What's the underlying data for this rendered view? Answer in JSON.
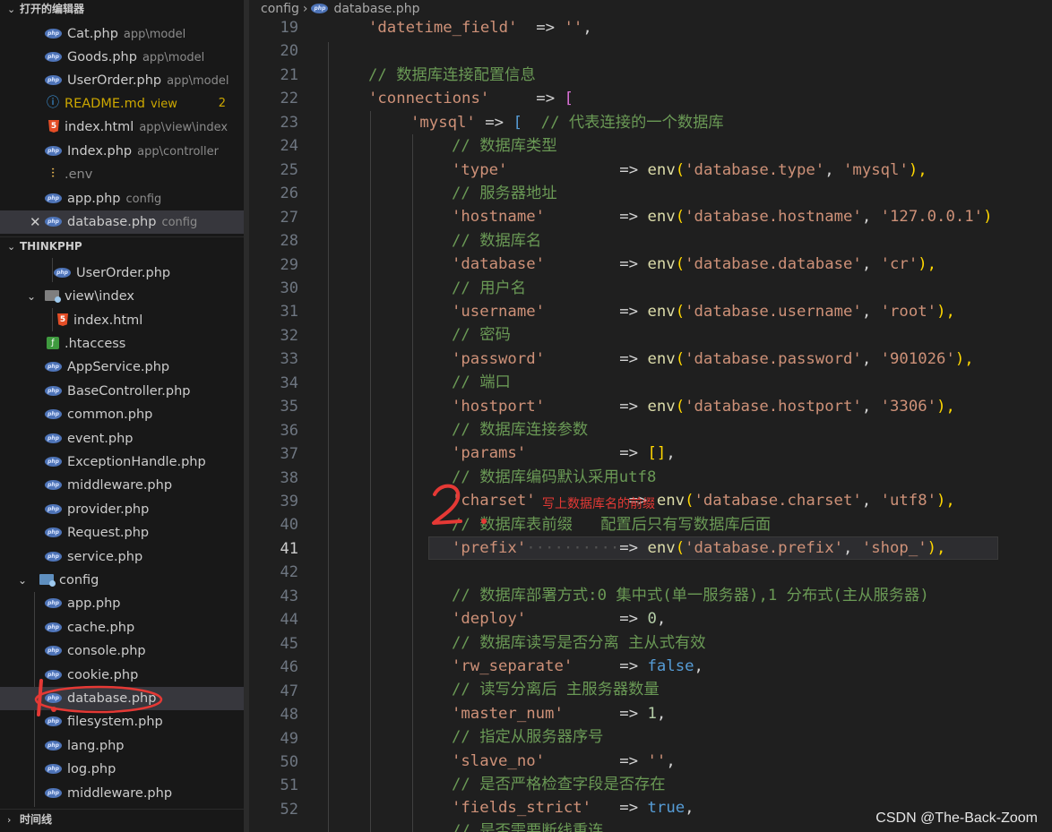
{
  "open_editors": {
    "title": "打开的编辑器",
    "items": [
      {
        "name": "Cat.php",
        "hint": "app\\model"
      },
      {
        "name": "Goods.php",
        "hint": "app\\model"
      },
      {
        "name": "UserOrder.php",
        "hint": "app\\model"
      },
      {
        "name": "README.md",
        "hint": "view",
        "badge": "2"
      },
      {
        "name": "index.html",
        "hint": "app\\view\\index"
      },
      {
        "name": "Index.php",
        "hint": "app\\controller"
      },
      {
        "name": ".env",
        "hint": ""
      },
      {
        "name": "app.php",
        "hint": "config"
      },
      {
        "name": "database.php",
        "hint": "config"
      }
    ]
  },
  "explorer": {
    "title": "THINKPHP",
    "rows": [
      "UserOrder.php",
      "view\\index",
      "index.html",
      ".htaccess",
      "AppService.php",
      "BaseController.php",
      "common.php",
      "event.php",
      "ExceptionHandle.php",
      "middleware.php",
      "provider.php",
      "Request.php",
      "service.php",
      "config",
      "app.php",
      "cache.php",
      "console.php",
      "cookie.php",
      "database.php",
      "filesystem.php",
      "lang.php",
      "log.php",
      "middleware.php"
    ]
  },
  "timeline": {
    "title": "时间线"
  },
  "breadcrumb": {
    "folder": "config",
    "file": "database.php"
  },
  "code": {
    "line_numbers": [
      "19",
      "20",
      "21",
      "22",
      "23",
      "24",
      "25",
      "26",
      "27",
      "28",
      "29",
      "30",
      "31",
      "32",
      "33",
      "34",
      "35",
      "36",
      "37",
      "38",
      "39",
      "40",
      "41",
      "42",
      "43",
      "44",
      "45",
      "46",
      "47",
      "48",
      "49",
      "50",
      "51",
      "52"
    ],
    "current_line": "41",
    "lines": {
      "l19": {
        "k": "'datetime_field'",
        "op": "  => ",
        "v": "''",
        "end": ","
      },
      "l21": "// 数据库连接配置信息",
      "l22": {
        "k": "'connections'",
        "op": "     => ",
        "br": "["
      },
      "l23": {
        "k": "'mysql'",
        "op": " => ",
        "br": "[",
        "cm": "  // 代表连接的一个数据库"
      },
      "l24": "// 数据库类型",
      "l25": {
        "k": "'type'",
        "op": "            => ",
        "fn": "env",
        "a": "'database.type'",
        "sep": ", ",
        "b": "'mysql'",
        "end": "),"
      },
      "l26": "// 服务器地址",
      "l27": {
        "k": "'hostname'",
        "op": "        => ",
        "fn": "env",
        "a": "'database.hostname'",
        "sep": ", ",
        "b": "'127.0.0.1'",
        "end": ")"
      },
      "l28": "// 数据库名",
      "l29": {
        "k": "'database'",
        "op": "        => ",
        "fn": "env",
        "a": "'database.database'",
        "sep": ", ",
        "b": "'cr'",
        "end": "),"
      },
      "l30": "// 用户名",
      "l31": {
        "k": "'username'",
        "op": "        => ",
        "fn": "env",
        "a": "'database.username'",
        "sep": ", ",
        "b": "'root'",
        "end": "),"
      },
      "l32": "// 密码",
      "l33": {
        "k": "'password'",
        "op": "        => ",
        "fn": "env",
        "a": "'database.password'",
        "sep": ", ",
        "b": "'901026'",
        "end": "),"
      },
      "l34": "// 端口",
      "l35": {
        "k": "'hostport'",
        "op": "        => ",
        "fn": "env",
        "a": "'database.hostport'",
        "sep": ", ",
        "b": "'3306'",
        "end": "),"
      },
      "l36": "// 数据库连接参数",
      "l37": {
        "k": "'params'",
        "op": "          => ",
        "br": "[]",
        "end": ","
      },
      "l38": "// 数据库编码默认采用utf8",
      "l39": {
        "k": "'charset'",
        "op": "=> ",
        "fn": "env",
        "a": "'database.charset'",
        "sep": ", ",
        "b": "'utf8'",
        "end": "),"
      },
      "l40": "// 数据库表前缀   配置后只有写数据库后面",
      "l41": {
        "k": "'prefix'",
        "op": "=> ",
        "fn": "env",
        "a": "'database.prefix'",
        "sep": ", ",
        "b": "'shop_'",
        "end": "),"
      },
      "l43": "// 数据库部署方式:0 集中式(单一服务器),1 分布式(主从服务器)",
      "l44": {
        "k": "'deploy'",
        "op": "          => ",
        "v": "0",
        "end": ","
      },
      "l45": "// 数据库读写是否分离 主从式有效",
      "l46": {
        "k": "'rw_separate'",
        "op": "     => ",
        "v": "false",
        "end": ","
      },
      "l47": "// 读写分离后 主服务器数量",
      "l48": {
        "k": "'master_num'",
        "op": "      => ",
        "v": "1",
        "end": ","
      },
      "l49": "// 指定从服务器序号",
      "l50": {
        "k": "'slave_no'",
        "op": "        => ",
        "v": "''",
        "end": ","
      },
      "l51": "// 是否严格检查字段是否存在",
      "l52": {
        "k": "'fields_strict'",
        "op": "   => ",
        "v": "true",
        "end": ","
      },
      "l53": "// 是否需要断线重连"
    }
  },
  "annotations": {
    "note": "写上数据库名的前缀",
    "n1": "1.",
    "n2": "2."
  },
  "watermark": "CSDN @The-Back-Zoom",
  "colors": {
    "string": "#ce9178",
    "comment": "#6a9955",
    "bracket": "#ffd700",
    "function": "#dcdcaa",
    "keyword": "#569cd6",
    "number": "#b5cea8",
    "annotation": "#e53935"
  }
}
